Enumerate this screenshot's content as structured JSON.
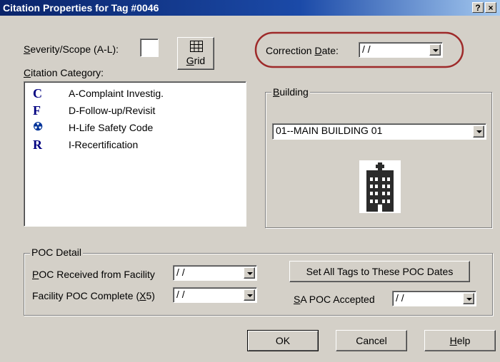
{
  "window": {
    "title": "Citation Properties for Tag #0046",
    "help_glyph": "?",
    "close_glyph": "×"
  },
  "severity": {
    "label_pre": "S",
    "label_post": "everity/Scope (A-L):",
    "value": ""
  },
  "grid_button": {
    "label_pre": "G",
    "label_post": "rid"
  },
  "category": {
    "label_pre": "C",
    "label_post": "itation Category:",
    "items": [
      {
        "icon": "complaint-icon",
        "glyph": "C",
        "label": "A-Complaint Investig."
      },
      {
        "icon": "followup-icon",
        "glyph": "F",
        "label": "D-Follow-up/Revisit"
      },
      {
        "icon": "life-safety-icon",
        "glyph": "☢",
        "label": "H-Life Safety Code"
      },
      {
        "icon": "recert-icon",
        "glyph": "R",
        "label": "I-Recertification"
      }
    ]
  },
  "correction_date": {
    "label_pre": "Correction ",
    "label_u": "D",
    "label_post": "ate:",
    "value": "/ /"
  },
  "building": {
    "label_pre": "B",
    "label_post": "uilding",
    "selected": "01--MAIN BUILDING 01",
    "icon": "hospital-building-icon"
  },
  "poc": {
    "group_label": "POC Detail",
    "received_label_pre": "P",
    "received_label_post": "OC Received from Facility",
    "received_value": "/ /",
    "complete_label_pre": "Facility POC Complete (",
    "complete_label_u": "X",
    "complete_label_post": "5)",
    "complete_value": "/ /",
    "set_all_label": "Set All Tags to These POC Dates",
    "sa_label_pre": "S",
    "sa_label_post": "A POC Accepted",
    "sa_value": "/ /"
  },
  "buttons": {
    "ok": "OK",
    "cancel": "Cancel",
    "help_pre": "H",
    "help_post": "elp"
  },
  "colors": {
    "title_bar": "#0a246a",
    "dialog_bg": "#d4d0c8",
    "highlight_ellipse": "#9e2a2a"
  }
}
